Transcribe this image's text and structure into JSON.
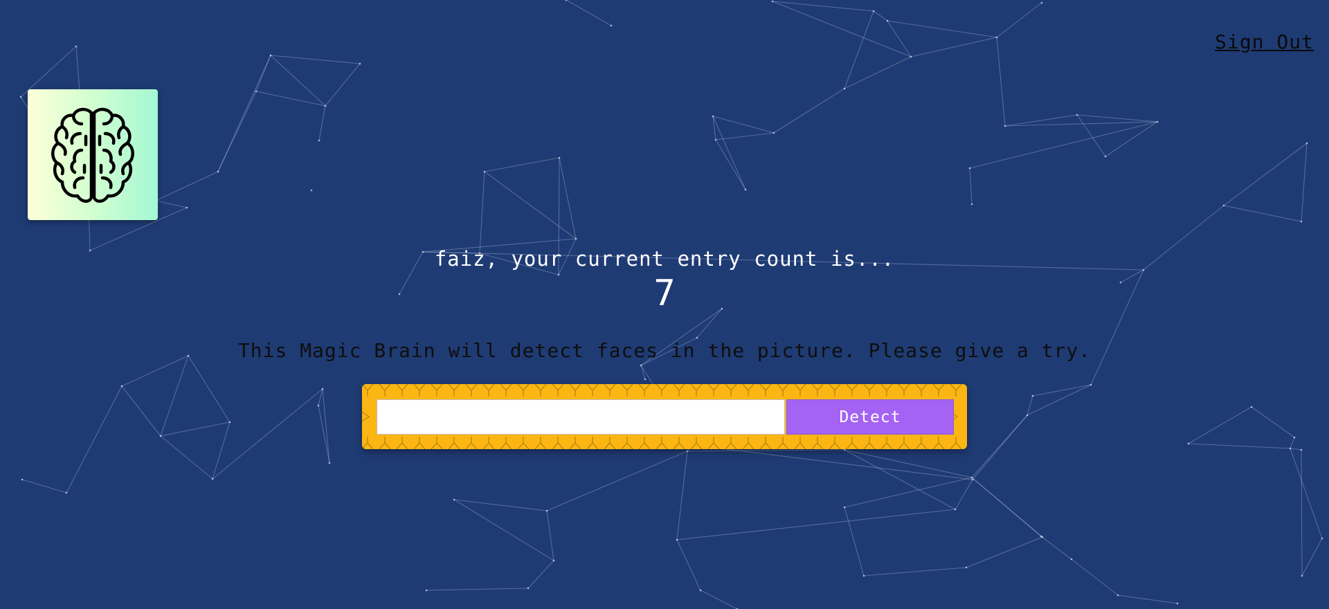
{
  "navigation": {
    "sign_out_label": "Sign Out"
  },
  "logo": {
    "icon": "brain-icon",
    "gradient_colors": [
      "#fcffd9",
      "#a4f7d4"
    ]
  },
  "rank": {
    "message": "faiz, your current entry count is...",
    "count": "7"
  },
  "intro": {
    "text": "This Magic Brain will detect faces in the picture. Please give a try."
  },
  "image_link_form": {
    "input_value": "",
    "input_placeholder": "",
    "detect_label": "Detect"
  },
  "colors": {
    "background": "#1f3b73",
    "form_background": "#fbb614",
    "detect_button": "#a463f2",
    "particles": "#c8d2f0"
  }
}
